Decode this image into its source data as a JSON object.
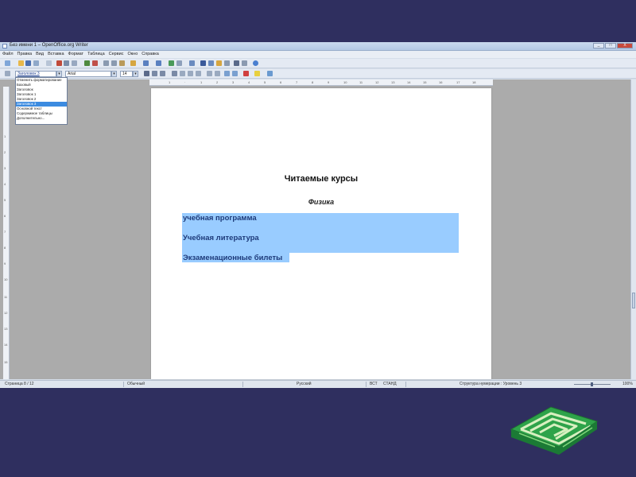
{
  "window": {
    "title": "Без имени 1 – OpenOffice.org Writer",
    "controls": [
      "_",
      "□",
      "X"
    ]
  },
  "menu": [
    "Файл",
    "Правка",
    "Вид",
    "Вставка",
    "Формат",
    "Таблица",
    "Сервис",
    "Окно",
    "Справка"
  ],
  "formatting": {
    "style_value": "Заголовок 3",
    "font_value": "Arial",
    "size_value": "14"
  },
  "style_dropdown": {
    "items": [
      "Отменить форматирование",
      "Базовый",
      "Заголовок",
      "Заголовок 1",
      "Заголовок 2",
      "Заголовок 3",
      "Основной текст",
      "Содержимое таблицы",
      "Дополнительно..."
    ],
    "highlighted_index": 5
  },
  "document": {
    "title": "Читаемые курсы",
    "subtitle": "Физика",
    "lines": [
      "учебная программа",
      "Учебная литература",
      "Экзаменационные билеты"
    ]
  },
  "status": {
    "page": "Страница 8 / 12",
    "style": "Обычный",
    "language": "Русский",
    "insert_mode": "ВСТ",
    "selection_mode": "СТАНД",
    "outline": "Структура нумерации : Уровень 3",
    "zoom": "100%"
  },
  "colors": {
    "highlight": "#99ccff",
    "slide_bg": "#2f2f5f",
    "logo_green": "#2ea34a"
  }
}
